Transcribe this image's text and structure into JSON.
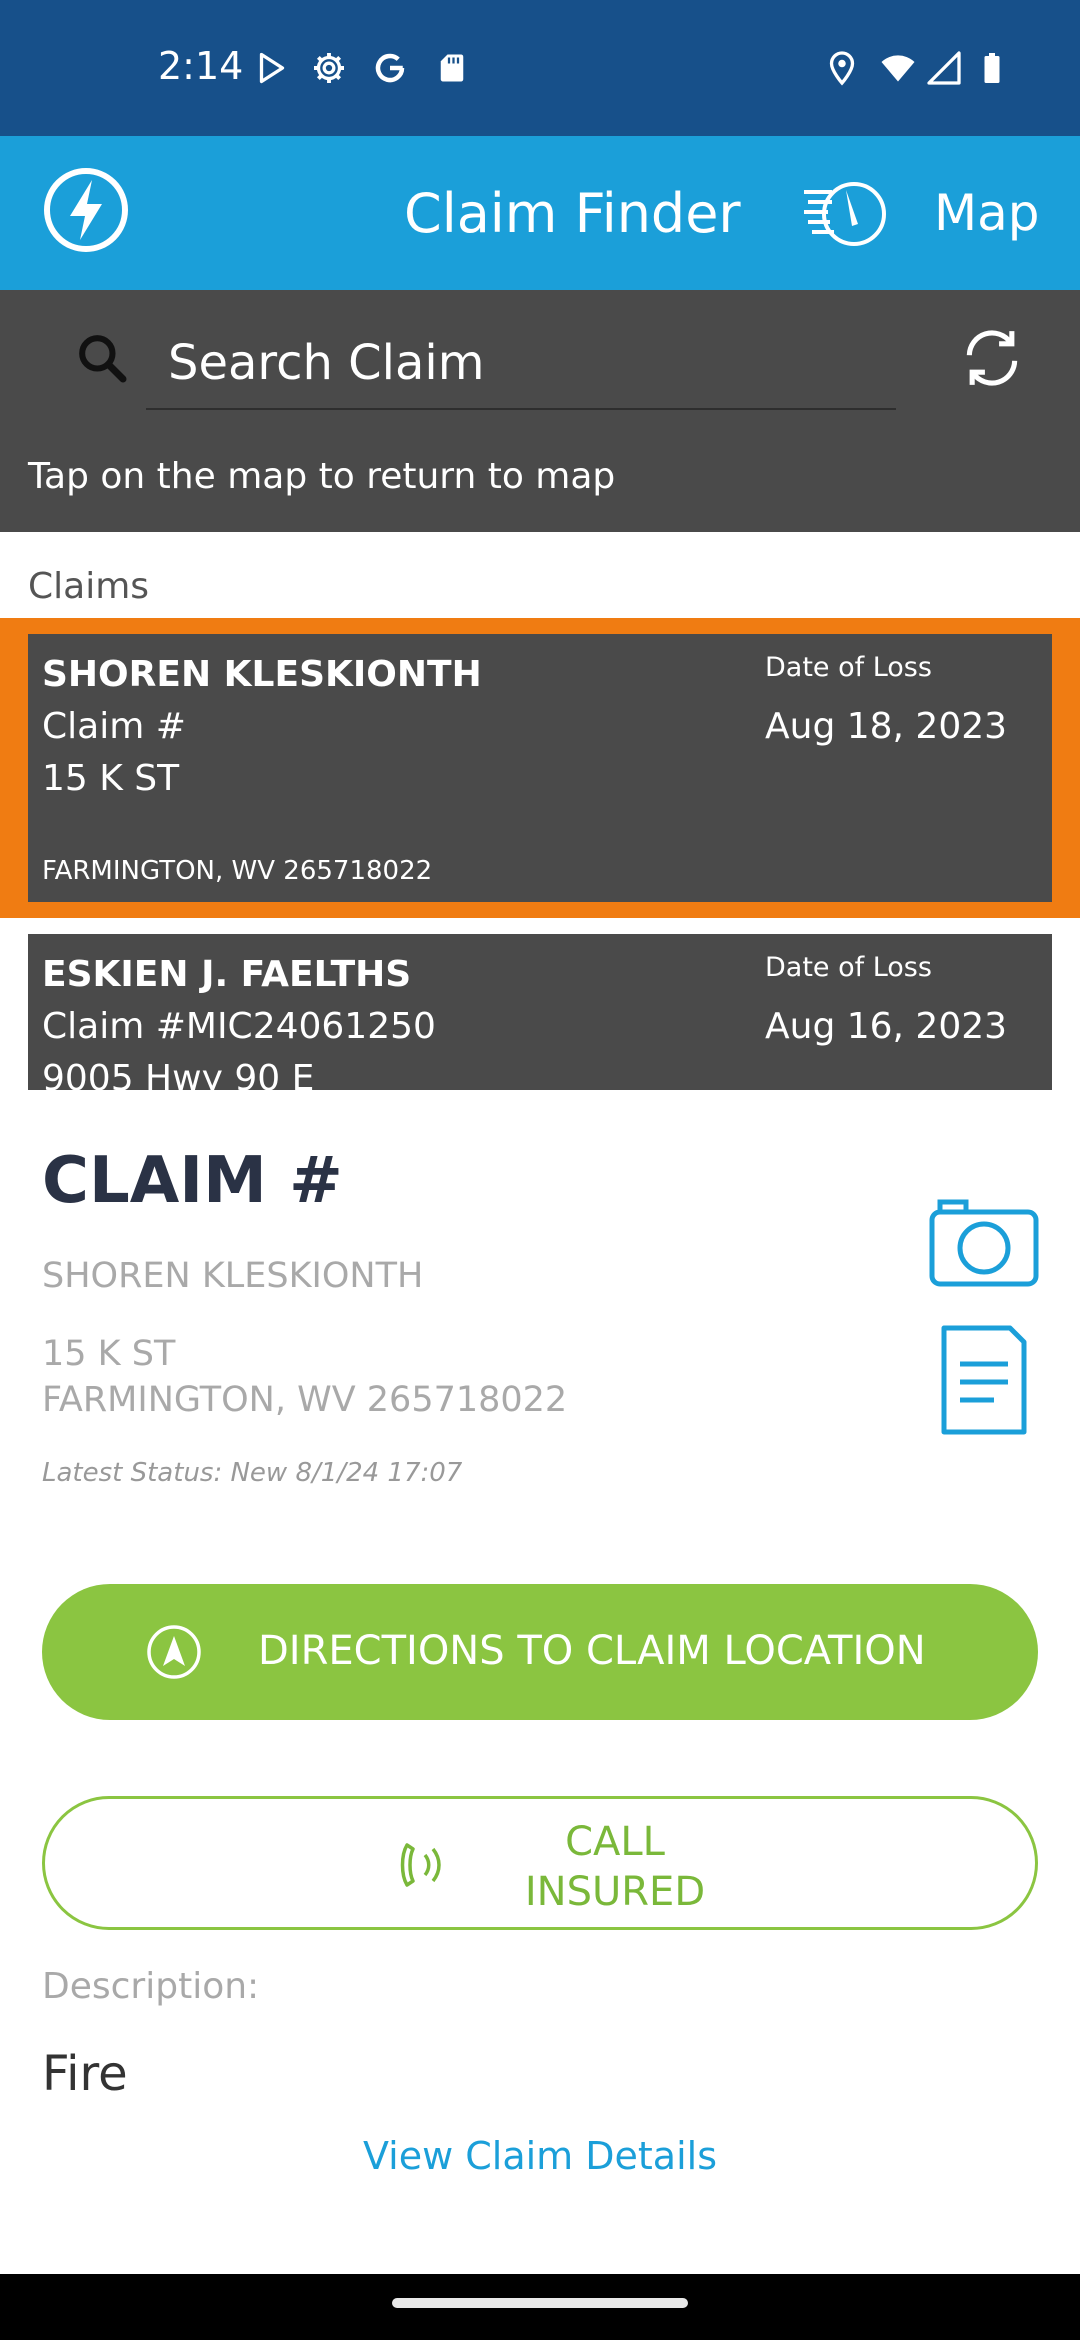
{
  "status_bar": {
    "time": "2:14",
    "left_icons": [
      "play-store-icon",
      "gear-icon",
      "google-icon",
      "sd-card-icon"
    ],
    "right_icons": [
      "location-icon",
      "wifi-icon",
      "signal-icon",
      "battery-icon"
    ]
  },
  "app_bar": {
    "title": "Claim Finder",
    "map_label": "Map",
    "logo_icon": "lightning-logo-icon",
    "map_icon": "speed-compass-icon",
    "bg_color": "#1b9fd9"
  },
  "search": {
    "placeholder": "Search Claim",
    "value": "",
    "hint": "Tap on the map to return to map"
  },
  "claims": {
    "heading": "Claims",
    "date_label": "Date of Loss",
    "selected_color": "#f07c12",
    "items": [
      {
        "name": "SHOREN KLESKIONTH",
        "claim_no": "Claim #",
        "street": "15 K ST",
        "city": "FARMINGTON, WV 265718022",
        "date": "Aug 18, 2023"
      },
      {
        "name": "ESKIEN J. FAELTHS",
        "claim_no": "Claim #MIC24061250",
        "street": "9005 Hwy 90 E",
        "city": "",
        "date": "Aug 16, 2023"
      }
    ]
  },
  "detail": {
    "title": "CLAIM #",
    "name": "SHOREN KLESKIONTH",
    "street": "15 K ST",
    "city": "FARMINGTON, WV 265718022",
    "status": "Latest Status: New 8/1/24 17:07",
    "directions_label": "DIRECTIONS TO CLAIM LOCATION",
    "call_label": "CALL INSURED",
    "description_label": "Description:",
    "description": "Fire",
    "view_details": "View Claim Details",
    "accent_green": "#8bc541",
    "icon_blue": "#1b9fd9"
  }
}
